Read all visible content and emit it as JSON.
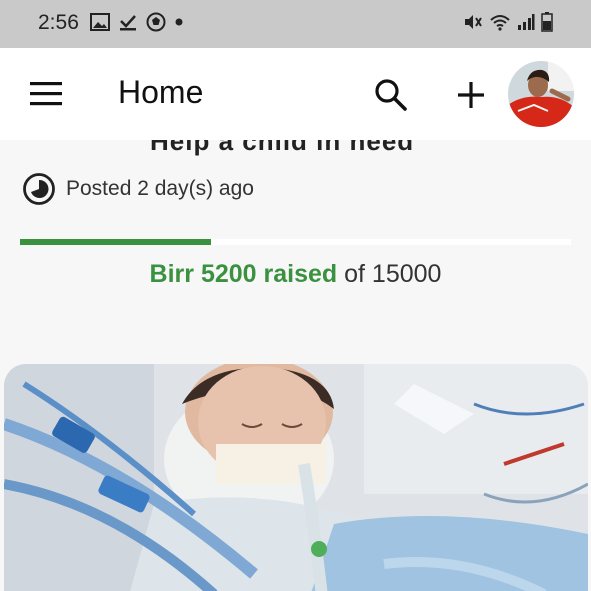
{
  "status_bar": {
    "time": "2:56",
    "left_icons": [
      "image-icon",
      "download-done-icon",
      "soccer-ball-icon",
      "dot-icon"
    ],
    "right_icons": [
      "mute-icon",
      "wifi-icon",
      "signal-icon",
      "battery-icon"
    ]
  },
  "app_bar": {
    "title": "Home",
    "icons": [
      "menu-icon",
      "search-icon",
      "add-icon"
    ]
  },
  "post": {
    "title_partial": "Help a child in need",
    "posted_text": "Posted 2 day(s) ago",
    "raised_amount": "Birr 5200 raised",
    "raised_of": " of 15000",
    "progress_fraction": 0.3467
  },
  "colors": {
    "accent_green": "#3a9140",
    "status_bar": "#c9c9c9",
    "app_bar": "#ffffff",
    "background": "#f7f7f7"
  }
}
